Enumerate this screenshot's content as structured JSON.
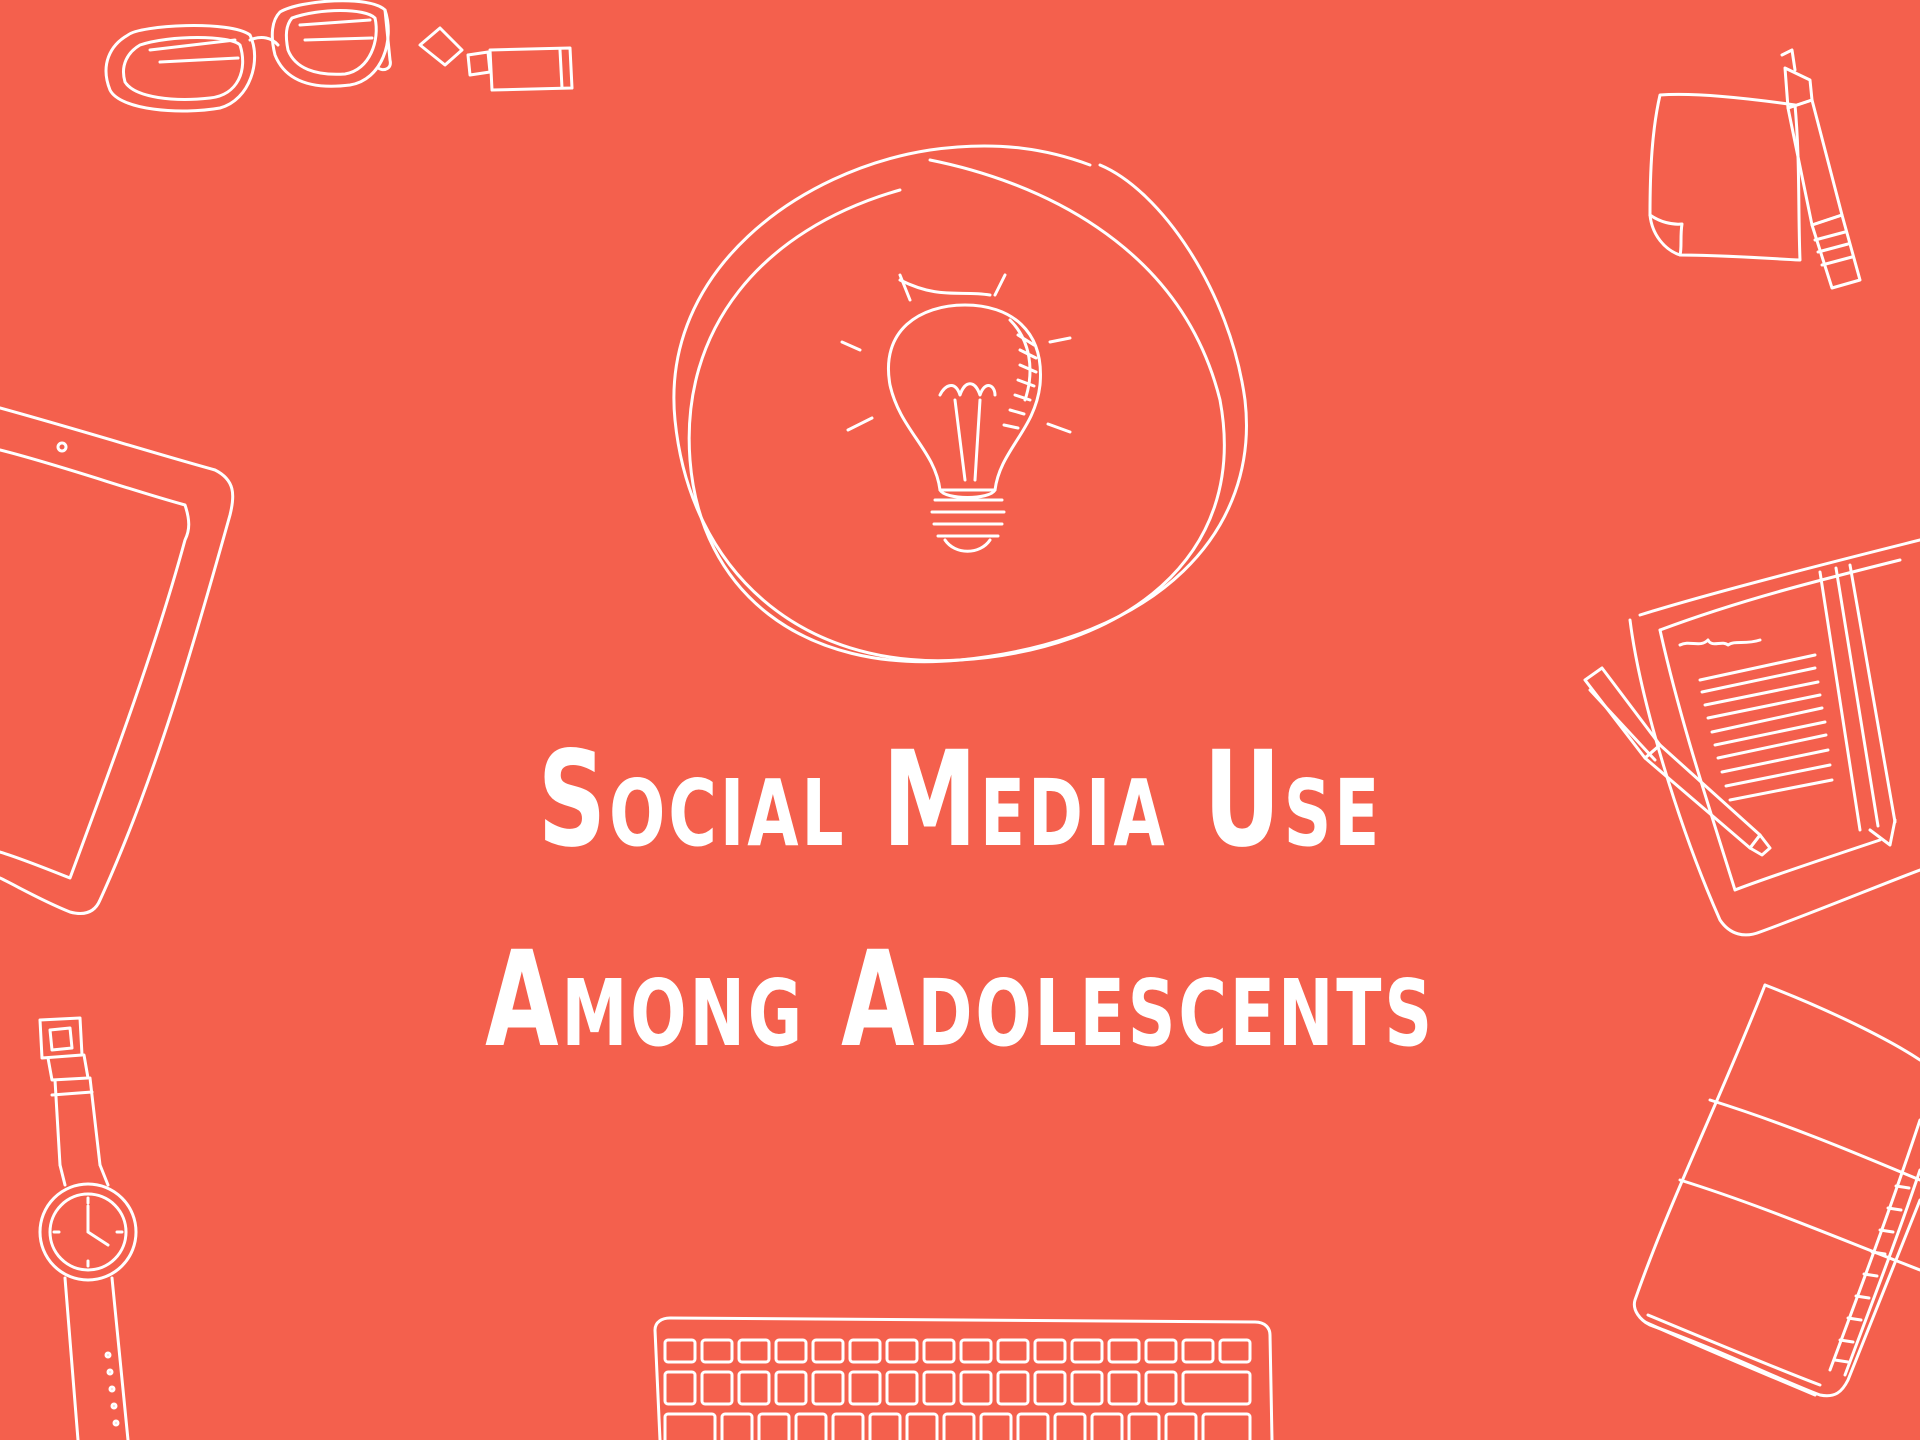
{
  "slide": {
    "title_line1": "Social Media Use",
    "title_line2": "Among Adolescents",
    "background_color": "#F4604D",
    "text_color": "#FFFFFF"
  },
  "icons": [
    "glasses-icon",
    "usb-drive-icon",
    "sticky-note-icon",
    "marker-icon",
    "tablet-icon",
    "lightbulb-icon",
    "open-notebook-icon",
    "pen-icon",
    "wristwatch-icon",
    "keyboard-icon",
    "closed-notebook-icon"
  ]
}
